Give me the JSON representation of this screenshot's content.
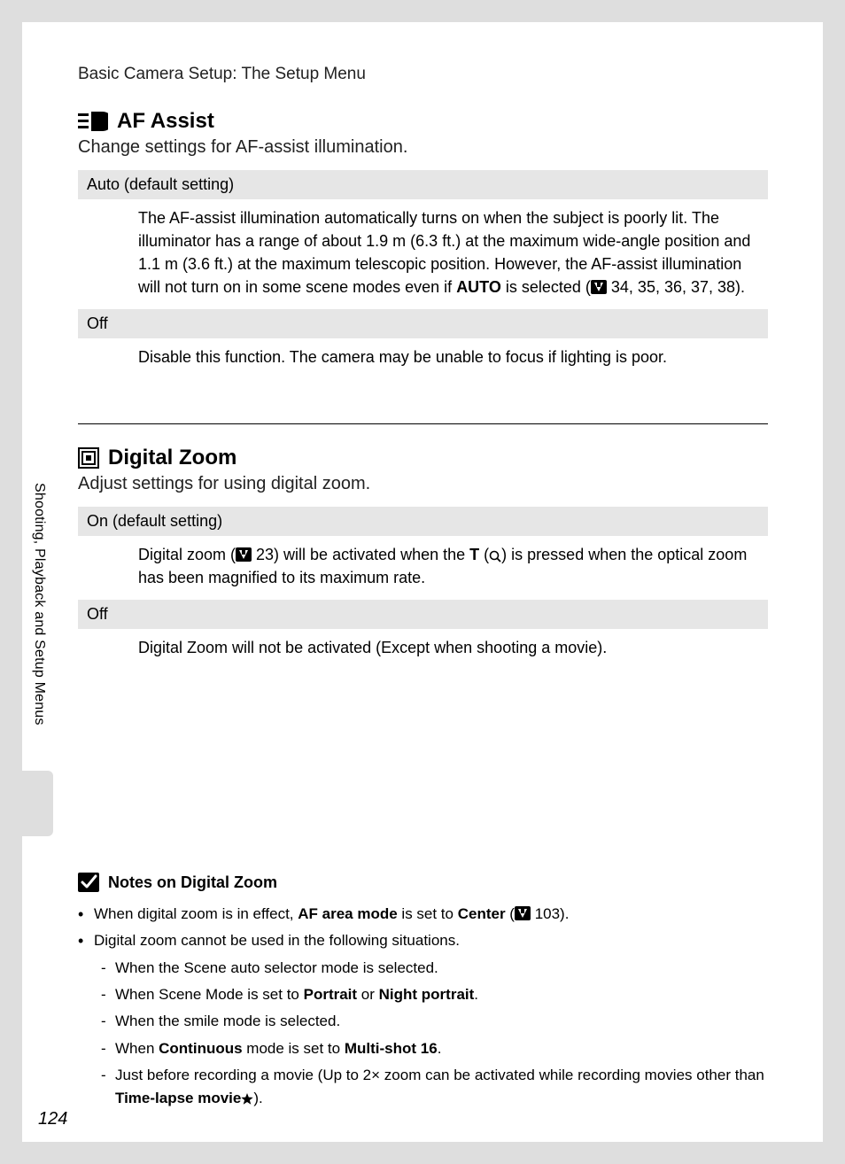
{
  "header": "Basic Camera Setup: The Setup Menu",
  "sec1": {
    "title": "AF Assist",
    "sub": "Change settings for AF-assist illumination.",
    "rows": [
      {
        "head": "Auto (default setting)",
        "body_pre": "The AF-assist illumination automatically turns on when the subject is poorly lit. The illuminator has a range of about 1.9 m (6.3 ft.) at the maximum wide-angle position and 1.1 m (3.6 ft.) at the maximum telescopic position. However, the AF-assist illumination will not turn on in some scene modes even if ",
        "body_bold": "AUTO",
        "body_mid": " is selected (",
        "body_post": " 34, 35, 36, 37, 38)."
      },
      {
        "head": "Off",
        "body": "Disable this function. The camera may be unable to focus if lighting is poor."
      }
    ]
  },
  "sec2": {
    "title": "Digital Zoom",
    "sub": "Adjust settings for using digital zoom.",
    "rows": [
      {
        "head": "On (default setting)",
        "b_pre": "Digital zoom (",
        "b_ref": " 23) will be activated when the ",
        "b_T": "T",
        "b_mid": "  (",
        "b_post": ") is pressed when the optical zoom has been magnified to its maximum rate."
      },
      {
        "head": "Off",
        "body": "Digital Zoom will not be activated (Except when shooting a movie)."
      }
    ]
  },
  "side_label": "Shooting, Playback and Setup Menus",
  "notes": {
    "title": "Notes on Digital Zoom",
    "b1_pre": "When digital zoom is in effect, ",
    "b1_b1": "AF area mode",
    "b1_mid": " is set to ",
    "b1_b2": "Center",
    "b1_paren_open": " (",
    "b1_post": " 103).",
    "b2": "Digital zoom cannot be used in the following situations.",
    "sub1": "When the Scene auto selector mode is selected.",
    "sub2_pre": "When Scene Mode is set to ",
    "sub2_b1": "Portrait",
    "sub2_mid": " or ",
    "sub2_b2": "Night portrait",
    "sub2_post": ".",
    "sub3": "When the smile mode is selected.",
    "sub4_pre": "When ",
    "sub4_b1": "Continuous",
    "sub4_mid": " mode is set to ",
    "sub4_b2": "Multi-shot 16",
    "sub4_post": ".",
    "sub5_pre": "Just before recording a movie (Up to 2× zoom can be activated while recording movies other than ",
    "sub5_b": "Time-lapse movie",
    "sub5_post": ")."
  },
  "page_number": "124"
}
